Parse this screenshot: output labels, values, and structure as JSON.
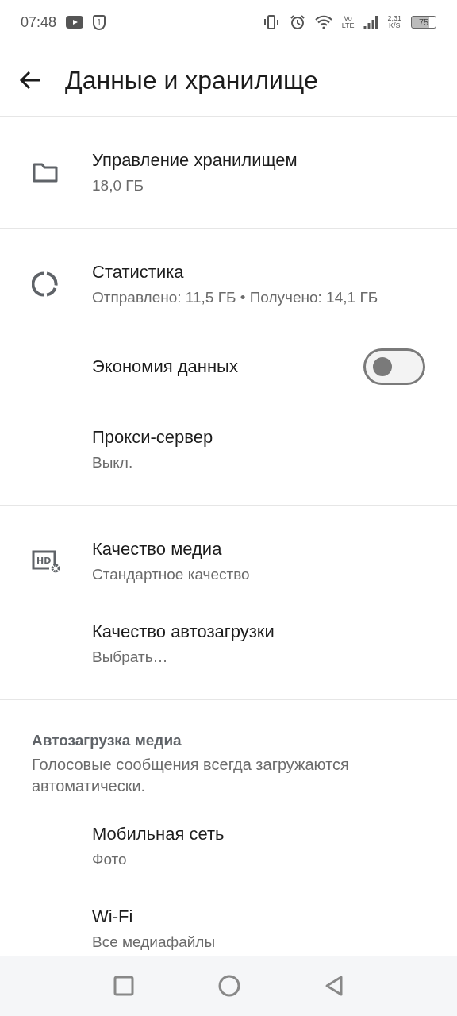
{
  "status_bar": {
    "time": "07:48",
    "shield_count": "1",
    "volte_top": "Vo",
    "volte_bottom": "LTE",
    "speed_value": "2,31",
    "speed_unit": "K/S",
    "battery": "75"
  },
  "header": {
    "title": "Данные и хранилище"
  },
  "sections": [
    {
      "items": [
        {
          "kind": "folder",
          "title": "Управление хранилищем",
          "subtitle": "18,0 ГБ"
        }
      ]
    },
    {
      "items": [
        {
          "kind": "chart",
          "title": "Статистика",
          "subtitle": "Отправлено: 11,5 ГБ • Получено: 14,1 ГБ"
        },
        {
          "kind": "switch",
          "title": "Экономия данных",
          "on": false
        },
        {
          "kind": "text",
          "title": "Прокси-сервер",
          "subtitle": "Выкл."
        }
      ]
    },
    {
      "items": [
        {
          "kind": "hd",
          "icon_label": "HD",
          "title": "Качество медиа",
          "subtitle": "Стандартное качество"
        },
        {
          "kind": "text",
          "title": "Качество автозагрузки",
          "subtitle": "Выбрать…"
        }
      ]
    },
    {
      "heading": "Автозагрузка медиа",
      "description": "Голосовые сообщения всегда загружаются автоматически.",
      "items": [
        {
          "kind": "text",
          "title": "Мобильная сеть",
          "subtitle": "Фото"
        },
        {
          "kind": "text",
          "title": "Wi-Fi",
          "subtitle": "Все медиафайлы"
        }
      ]
    }
  ]
}
